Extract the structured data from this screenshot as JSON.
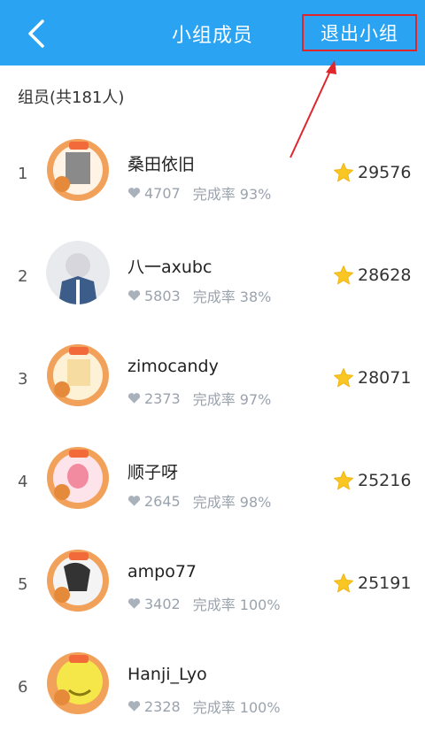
{
  "header": {
    "title": "小组成员",
    "exit_label": "退出小组"
  },
  "member_count": "组员(共181人)",
  "members": [
    {
      "rank": "1",
      "name": "桑田依旧",
      "likes": "4707",
      "completion": "完成率 93%",
      "score": "29576",
      "avatar_color": "#f2a15a"
    },
    {
      "rank": "2",
      "name": "八一axubc",
      "likes": "5803",
      "completion": "完成率 38%",
      "score": "28628",
      "avatar_color": "#3c5c8a"
    },
    {
      "rank": "3",
      "name": "zimocandy",
      "likes": "2373",
      "completion": "完成率 97%",
      "score": "28071",
      "avatar_color": "#f2a15a"
    },
    {
      "rank": "4",
      "name": "顺子呀",
      "likes": "2645",
      "completion": "完成率 98%",
      "score": "25216",
      "avatar_color": "#f28aa0"
    },
    {
      "rank": "5",
      "name": "ampo77",
      "likes": "3402",
      "completion": "完成率 100%",
      "score": "25191",
      "avatar_color": "#f2a15a"
    },
    {
      "rank": "6",
      "name": "Hanji_Lyo",
      "likes": "2328",
      "completion": "完成率 100%",
      "score": "",
      "avatar_color": "#f5e64a"
    }
  ],
  "colors": {
    "header_bg": "#2aa3f3",
    "highlight_border": "#e0262d",
    "star": "#f9c623"
  }
}
